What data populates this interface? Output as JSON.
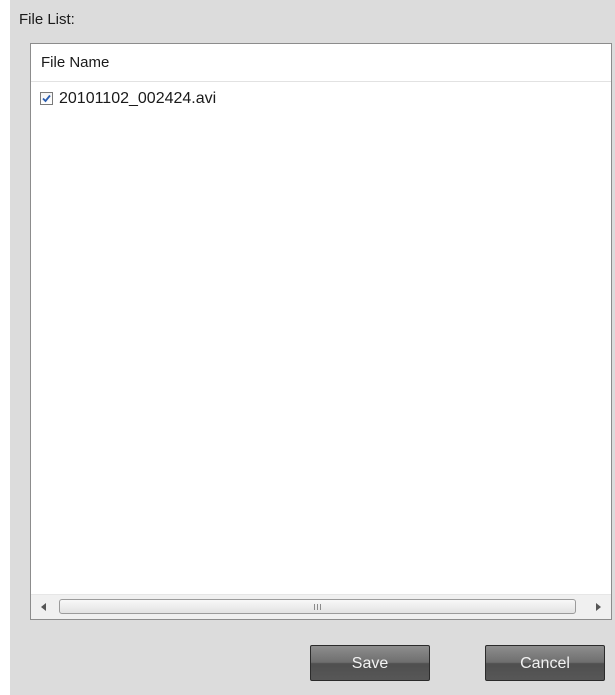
{
  "file_list": {
    "label": "File List:",
    "column_header": "File Name",
    "rows": [
      {
        "name": "20101102_002424.avi",
        "checked": true
      }
    ],
    "scrollbar": {
      "left_icon": "scroll-left-arrow-icon",
      "right_icon": "scroll-right-arrow-icon",
      "grip_icon": "grip-icon"
    }
  },
  "actions": {
    "save_label": "Save",
    "cancel_label": "Cancel"
  },
  "colors": {
    "dialog_bg": "#dcdcdc",
    "list_bg": "#ffffff",
    "check_color": "#2a5db0",
    "button_bg": "#6e6e6e",
    "button_text": "#f2f2f2"
  }
}
